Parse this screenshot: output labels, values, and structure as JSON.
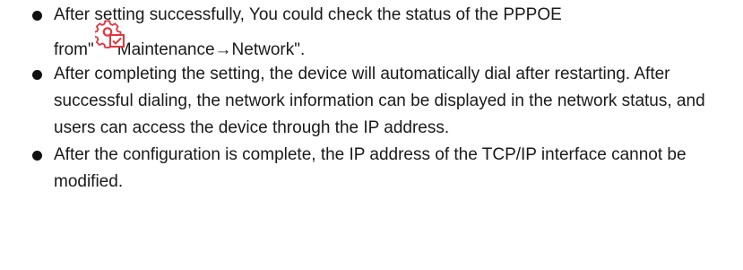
{
  "bullets": [
    {
      "line_a": "After setting successfully, You could check the status of the PPPOE",
      "line_b_prefix": "from\"",
      "line_b_suffix": "Maintenance→Network\".",
      "icon": "gear-settings-icon"
    },
    {
      "text": "After completing the setting, the device will automatically dial after restarting. After successful dialing, the network information can be displayed in the network status, and users can access the device through the IP address."
    },
    {
      "text": "After the configuration is complete, the IP address of the TCP/IP interface cannot be modified."
    }
  ],
  "colors": {
    "icon_red": "#e2363f",
    "text": "#1a1a1a"
  }
}
